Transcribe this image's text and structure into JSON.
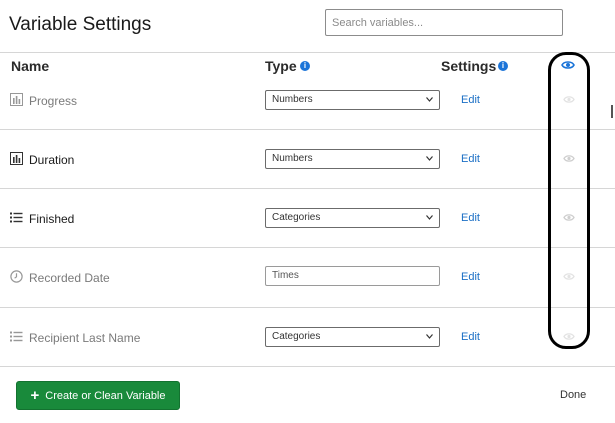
{
  "header": {
    "title": "Variable Settings",
    "search_placeholder": "Search variables..."
  },
  "columns": {
    "name": "Name",
    "type": "Type",
    "settings": "Settings"
  },
  "rows": [
    {
      "icon": "bar-chart-icon",
      "label": "Progress",
      "type": "Numbers",
      "type_control": "select",
      "edit": "Edit",
      "dimmed": true
    },
    {
      "icon": "bar-chart-icon",
      "label": "Duration",
      "type": "Numbers",
      "type_control": "select",
      "edit": "Edit",
      "dimmed": false
    },
    {
      "icon": "list-icon",
      "label": "Finished",
      "type": "Categories",
      "type_control": "select",
      "edit": "Edit",
      "dimmed": false
    },
    {
      "icon": "clock-icon",
      "label": "Recorded Date",
      "type": "Times",
      "type_control": "text",
      "edit": "Edit",
      "dimmed": true
    },
    {
      "icon": "list-icon",
      "label": "Recipient Last Name",
      "type": "Categories",
      "type_control": "select",
      "edit": "Edit",
      "dimmed": true
    }
  ],
  "footer": {
    "create_label": "Create or Clean Variable",
    "done_label": "Done"
  },
  "colors": {
    "accent": "#1b74d8",
    "primary_button": "#198a3b",
    "link": "#1b6fc5"
  }
}
